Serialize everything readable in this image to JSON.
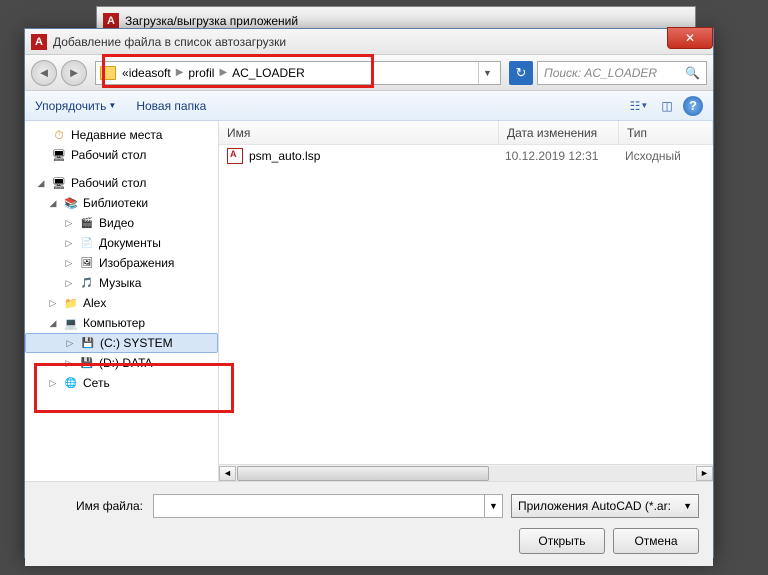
{
  "bg_title": "Загрузка/выгрузка приложений",
  "dialog_title": "Добавление файла в список автозагрузки",
  "breadcrumb": {
    "prefix": "«",
    "parts": [
      "ideasoft",
      "profil",
      "AC_LOADER"
    ]
  },
  "search": {
    "placeholder": "Поиск: AC_LOADER"
  },
  "toolbar": {
    "organize": "Упорядочить",
    "newfolder": "Новая папка"
  },
  "columns": {
    "name": "Имя",
    "date": "Дата изменения",
    "type": "Тип"
  },
  "files": [
    {
      "name": "psm_auto.lsp",
      "date": "10.12.2019 12:31",
      "type": "Исходный"
    }
  ],
  "sidebar": {
    "recent": "Недавние места",
    "desktop_fav": "Рабочий стол",
    "desktop": "Рабочий стол",
    "libs": "Библиотеки",
    "video": "Видео",
    "docs": "Документы",
    "img": "Изображения",
    "music": "Музыка",
    "user": "Alex",
    "computer": "Компьютер",
    "drive_c": "(C:) SYSTEM",
    "drive_d": "(D:) DATA",
    "network": "Сеть"
  },
  "footer": {
    "filename_label": "Имя файла:",
    "filter": "Приложения AutoCAD (*.ar:",
    "open": "Открыть",
    "cancel": "Отмена"
  }
}
